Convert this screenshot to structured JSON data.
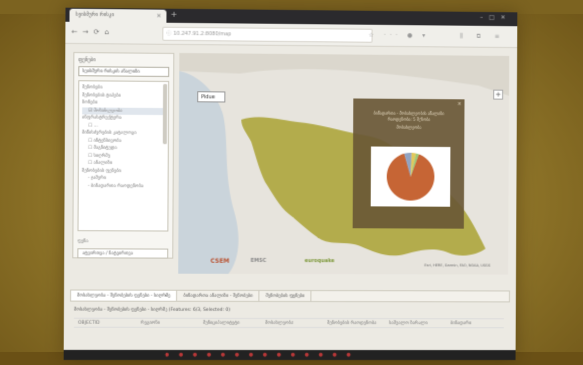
{
  "browser": {
    "tab_title": "სეისმური რისკი",
    "url": "10.247.91.2:8080/map",
    "nav_icons": [
      "back-icon",
      "forward-icon",
      "reload-icon",
      "home-icon"
    ]
  },
  "sidebar": {
    "title": "ფენები",
    "select_value": "სეისმური რისკის ანალიზი",
    "items": [
      {
        "label": "შენობები",
        "sub": false,
        "selected": false
      },
      {
        "label": "შენობების ტიპები",
        "sub": false,
        "selected": false
      },
      {
        "label": "ზონები",
        "sub": false,
        "selected": false
      },
      {
        "label": "☑ მოსახლეობა",
        "sub": true,
        "selected": true
      },
      {
        "label": "ინფრასტრუქტურა",
        "sub": false,
        "selected": false
      },
      {
        "label": "☐ ...",
        "sub": true,
        "selected": false
      },
      {
        "label": "მიწისძვრების კატალოგი",
        "sub": false,
        "selected": false
      },
      {
        "label": "☐ ინტენსივობა",
        "sub": true,
        "selected": false
      },
      {
        "label": "☐ მაგნიტუდა",
        "sub": true,
        "selected": false
      },
      {
        "label": "☐ სიღრმე",
        "sub": true,
        "selected": false
      },
      {
        "label": "☐ ანალიზი",
        "sub": true,
        "selected": false
      },
      {
        "label": "შენობების ფენები",
        "sub": false,
        "selected": false
      },
      {
        "label": "- ჯამური",
        "sub": true,
        "selected": false
      },
      {
        "label": "- ბინადართა რაოდენობა",
        "sub": true,
        "selected": false
      }
    ],
    "label_below": "ფენა",
    "button_label": "ატვირთვა / ჩატვირთვა"
  },
  "map": {
    "layer_select": "Pidue",
    "zoom_label": "+",
    "popup_text": "ბინადართა - მოსახლეობის ანალიზი რაოდენობა: 5 შენობა",
    "popup_sub": "მოსახლეობა",
    "popup_close": "×",
    "logo_csem": "CSEM",
    "logo_emsc": "EMSC",
    "logo_euro": "euroquake",
    "attribution": "Esri, HERE, Garmin, FAO, NOAA, USGS",
    "land_color": "#b5ad3c",
    "sea_color": "#c9d4dc",
    "pie_colors": [
      "#d4622a",
      "#8fa3c7",
      "#e6c84a",
      "#9ccb6a"
    ],
    "pie_fractions": [
      0.9,
      0.05,
      0.03,
      0.02
    ]
  },
  "bottom": {
    "tabs": [
      {
        "label": "მოსახლეობა - შენობების ფენები - სიღრმე",
        "active": true
      },
      {
        "label": "ბინადართა ანალიზი - შენობები",
        "active": false
      },
      {
        "label": "შენობების ფენები",
        "active": false
      }
    ],
    "caption": "მოსახლეობა - შენობების ფენები - სიღრმე (Features: 6/3, Selected: 0)",
    "columns": [
      "OBJECTID",
      "რეგიონი",
      "მუნიციპალიტეტი",
      "მოსახლეობა",
      "შენობების რაოდენობა",
      "საშუალო ზარალი",
      "ბინადარი"
    ]
  }
}
